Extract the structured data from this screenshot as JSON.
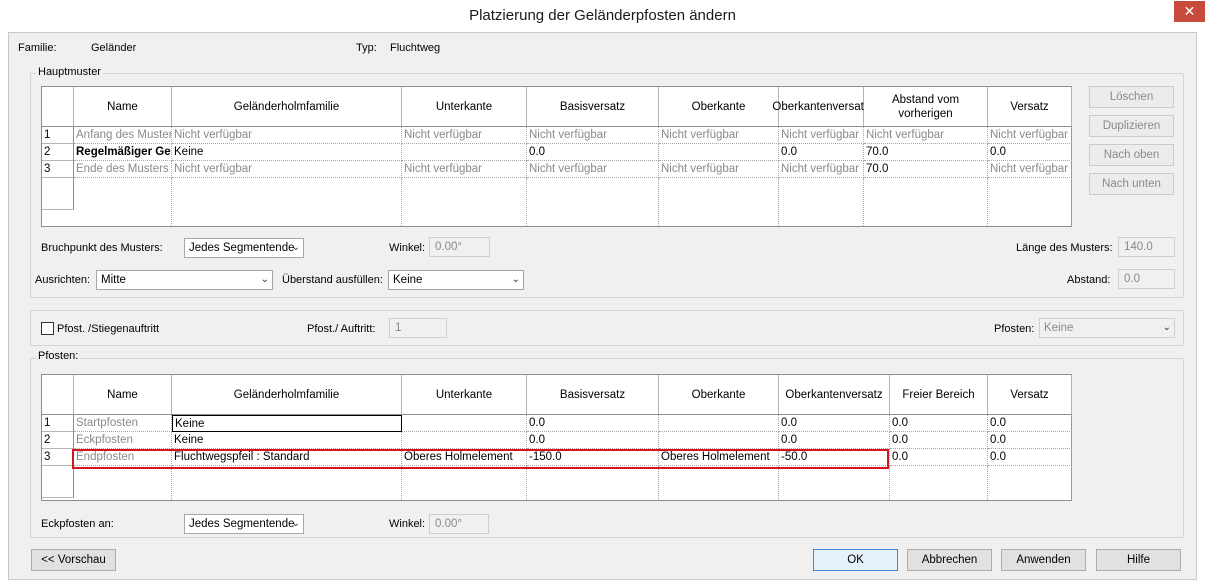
{
  "window": {
    "title": "Platzierung der Geländerpfosten ändern",
    "close_glyph": "✕"
  },
  "info": {
    "familie_label": "Familie:",
    "familie_value": "Geländer",
    "typ_label": "Typ:",
    "typ_value": "Fluchtweg"
  },
  "hauptmuster": {
    "group_label": "Hauptmuster",
    "columns": [
      "Name",
      "Geländerholmfamilie",
      "Unterkante",
      "Basisversatz",
      "Oberkante",
      "Oberkantenversatz",
      "Abstand vom vorherigen",
      "Versatz"
    ],
    "rows": [
      {
        "num": "1",
        "cells": [
          "Anfang des Musters",
          "Nicht verfügbar",
          "Nicht verfügbar",
          "Nicht verfügbar",
          "Nicht verfügbar",
          "Nicht verfügbar",
          "Nicht verfügbar",
          "Nicht verfügbar"
        ]
      },
      {
        "num": "2",
        "cells": [
          "Regelmäßiger Geländerpfosten",
          "Keine",
          "",
          "0.0",
          "",
          "0.0",
          "70.0",
          "0.0"
        ]
      },
      {
        "num": "3",
        "cells": [
          "Ende des Musters",
          "Nicht verfügbar",
          "Nicht verfügbar",
          "Nicht verfügbar",
          "Nicht verfügbar",
          "Nicht verfügbar",
          "70.0",
          "Nicht verfügbar"
        ]
      }
    ],
    "buttons": {
      "loeschen": "Löschen",
      "duplizieren": "Duplizieren",
      "nach_oben": "Nach oben",
      "nach_unten": "Nach unten"
    },
    "bruchpunkt_label": "Bruchpunkt des Musters:",
    "bruchpunkt_value": "Jedes Segmentende",
    "winkel_label": "Winkel:",
    "winkel_value": "0.00°",
    "laenge_label": "Länge des Musters:",
    "laenge_value": "140.0",
    "ausrichten_label": "Ausrichten:",
    "ausrichten_value": "Mitte",
    "ueberstand_label": "Überstand ausfüllen:",
    "ueberstand_value": "Keine",
    "abstand_label": "Abstand:",
    "abstand_value": "0.0"
  },
  "stiegen": {
    "checkbox_label": "Pfost. /Stiegenauftritt",
    "checked": false,
    "pfost_auftritt_label": "Pfost./ Auftritt:",
    "pfost_auftritt_value": "1",
    "pfosten_label": "Pfosten:",
    "pfosten_value": "Keine"
  },
  "pfosten": {
    "group_label": "Pfosten:",
    "columns": [
      "Name",
      "Geländerholmfamilie",
      "Unterkante",
      "Basisversatz",
      "Oberkante",
      "Oberkantenversatz",
      "Freier Bereich",
      "Versatz"
    ],
    "rows": [
      {
        "num": "1",
        "cells": [
          "Startpfosten",
          "Keine",
          "",
          "0.0",
          "",
          "0.0",
          "0.0",
          "0.0"
        ]
      },
      {
        "num": "2",
        "cells": [
          "Eckpfosten",
          "Keine",
          "",
          "0.0",
          "",
          "0.0",
          "0.0",
          "0.0"
        ]
      },
      {
        "num": "3",
        "cells": [
          "Endpfosten",
          "Fluchtwegspfeil : Standard",
          "Oberes Holmelement",
          "-150.0",
          "Oberes Holmelement",
          "-50.0",
          "0.0",
          "0.0"
        ]
      }
    ],
    "eckpfosten_label": "Eckpfosten an:",
    "eckpfosten_value": "Jedes Segmentende",
    "winkel_label": "Winkel:",
    "winkel_value": "0.00°"
  },
  "footer": {
    "vorschau": "<< Vorschau",
    "ok": "OK",
    "abbrechen": "Abbrechen",
    "anwenden": "Anwenden",
    "hilfe": "Hilfe"
  },
  "colors": {
    "highlight": "#d3131d",
    "dialog_bg": "#f0f0f0",
    "default_button_border": "#3b8bd8"
  }
}
